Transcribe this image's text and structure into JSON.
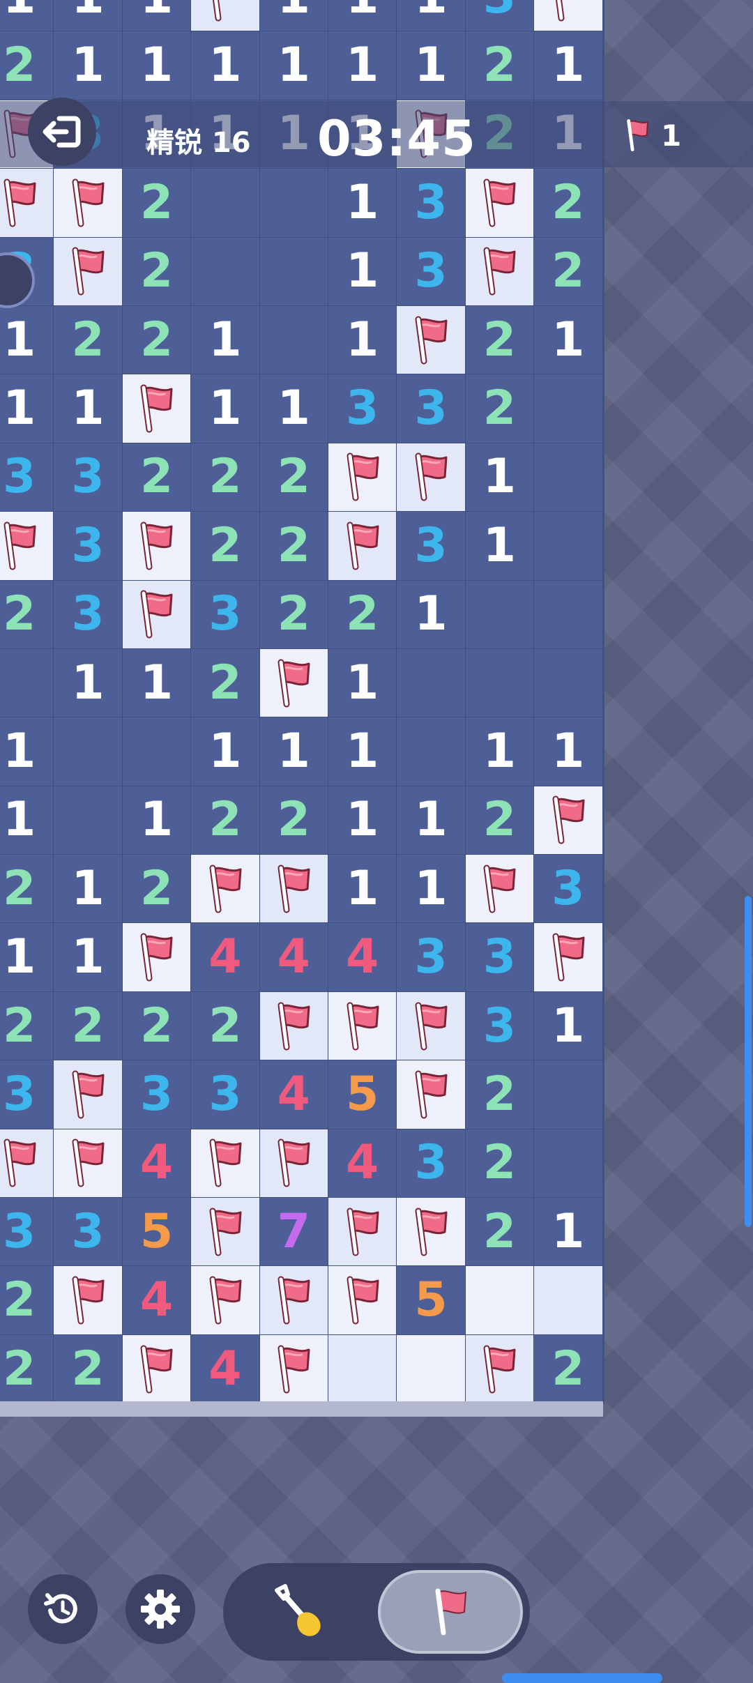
{
  "header": {
    "difficulty_label": "精锐 16",
    "timer": "03:45",
    "flags_placed": "1"
  },
  "board": {
    "columns": 9,
    "rows": [
      [
        "1",
        "1",
        "1",
        "F",
        "1",
        "1",
        "1",
        "3",
        "F"
      ],
      [
        "2",
        "1",
        "1",
        "1",
        "1",
        "1",
        "1",
        "2",
        "1"
      ],
      [
        "F",
        "3",
        "1",
        "1",
        "1",
        "1",
        "F",
        "2",
        "1"
      ],
      [
        "F",
        "F",
        "2",
        "",
        "",
        "1",
        "3",
        "F",
        "2"
      ],
      [
        "3",
        "F",
        "2",
        "",
        "",
        "1",
        "3",
        "F",
        "2"
      ],
      [
        "1",
        "2",
        "2",
        "1",
        "",
        "1",
        "F",
        "2",
        "1"
      ],
      [
        "1",
        "1",
        "F",
        "1",
        "1",
        "3",
        "3",
        "2",
        ""
      ],
      [
        "3",
        "3",
        "2",
        "2",
        "2",
        "F",
        "F",
        "1",
        ""
      ],
      [
        "F",
        "3",
        "F",
        "2",
        "2",
        "F",
        "3",
        "1",
        ""
      ],
      [
        "2",
        "3",
        "F",
        "3",
        "2",
        "2",
        "1",
        "",
        ""
      ],
      [
        "",
        "1",
        "1",
        "2",
        "F",
        "1",
        "",
        "",
        ""
      ],
      [
        "1",
        "",
        "",
        "1",
        "1",
        "1",
        "",
        "1",
        "1"
      ],
      [
        "1",
        "",
        "1",
        "2",
        "2",
        "1",
        "1",
        "2",
        "F"
      ],
      [
        "2",
        "1",
        "2",
        "F",
        "F",
        "1",
        "1",
        "F",
        "3"
      ],
      [
        "1",
        "1",
        "F",
        "4",
        "4",
        "4",
        "3",
        "3",
        "F"
      ],
      [
        "2",
        "2",
        "2",
        "2",
        "F",
        "F",
        "F",
        "3",
        "1"
      ],
      [
        "3",
        "F",
        "3",
        "3",
        "4",
        "5",
        "F",
        "2",
        ""
      ],
      [
        "F",
        "F",
        "4",
        "F",
        "F",
        "4",
        "3",
        "2",
        ""
      ],
      [
        "3",
        "3",
        "5",
        "F",
        "7",
        "F",
        "F",
        "2",
        "1"
      ],
      [
        "2",
        "F",
        "4",
        "F",
        "F",
        "F",
        "5",
        "U",
        "U"
      ],
      [
        "2",
        "2",
        "F",
        "4",
        "F",
        "U",
        "U",
        "F",
        "2"
      ]
    ]
  },
  "colors": {
    "open_cell": "#4e5f97",
    "closed_cell": "#eef1fc",
    "flag_red": "#f06b88",
    "n1": "#ffffff",
    "n2": "#8de3b6",
    "n3": "#3cb6ec",
    "n4": "#f05a7e",
    "n5": "#f59a4b",
    "n7": "#c46cf0",
    "accent_blue": "#3d8ef0"
  },
  "icons": {
    "exit": "exit-icon",
    "flag": "flag-icon",
    "restart": "restart-icon",
    "settings": "gear-icon",
    "dig_mode": "shovel-icon",
    "flag_mode": "flag-icon"
  },
  "mode": {
    "selected": "flag"
  }
}
